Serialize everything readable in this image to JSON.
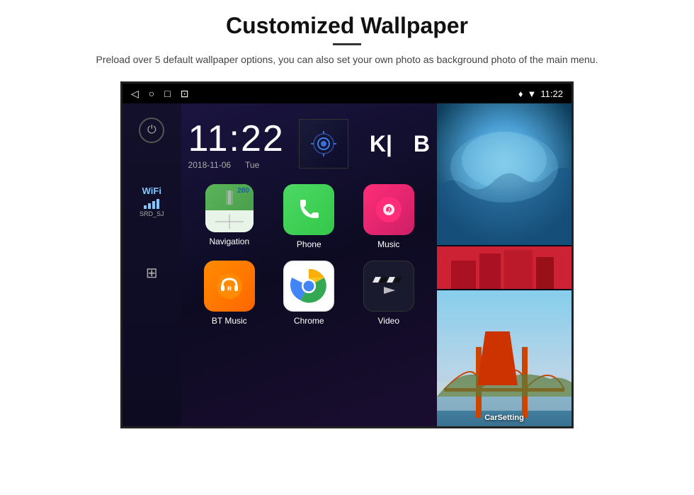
{
  "page": {
    "title": "Customized Wallpaper",
    "subtitle": "Preload over 5 default wallpaper options, you can also set your own photo as background photo of the main menu.",
    "divider": "—"
  },
  "status_bar": {
    "time": "11:22",
    "icons": {
      "back": "◁",
      "home": "○",
      "recent": "□",
      "screenshot": "⊡",
      "location": "♦",
      "wifi": "▼"
    }
  },
  "clock": {
    "time": "11:22",
    "date": "2018-11-06",
    "day": "Tue"
  },
  "wifi": {
    "label": "WiFi",
    "ssid": "SRD_SJ"
  },
  "apps": [
    {
      "id": "navigation",
      "label": "Navigation",
      "type": "maps"
    },
    {
      "id": "phone",
      "label": "Phone",
      "type": "phone"
    },
    {
      "id": "music",
      "label": "Music",
      "type": "music"
    },
    {
      "id": "bt-music",
      "label": "BT Music",
      "type": "bt"
    },
    {
      "id": "chrome",
      "label": "Chrome",
      "type": "chrome"
    },
    {
      "id": "video",
      "label": "Video",
      "type": "video"
    }
  ],
  "photo_labels": {
    "carsetting": "CarSetting"
  }
}
